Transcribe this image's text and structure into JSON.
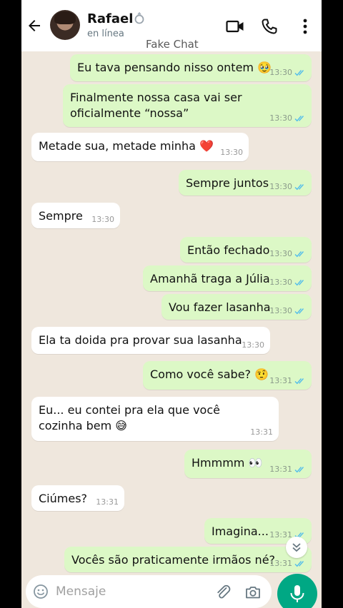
{
  "header": {
    "contact_name": "Rafael",
    "status": "en línea",
    "watermark": "Fake Chat"
  },
  "icons": {
    "back": "back-arrow-icon",
    "video": "video-call-icon",
    "call": "phone-icon",
    "more": "more-vertical-icon",
    "ring": "ring-icon",
    "emoji": "emoji-icon",
    "attach": "paperclip-icon",
    "camera": "camera-icon",
    "mic": "microphone-icon",
    "scroll": "double-chevron-down-icon"
  },
  "colors": {
    "outgoing_bubble": "#dcf8c6",
    "incoming_bubble": "#ffffff",
    "chat_background": "#efe7dd",
    "read_ticks": "#53bdeb",
    "accent": "#00a884"
  },
  "messages": [
    {
      "dir": "out",
      "text": "Eu tava pensando nisso ontem 🥹",
      "time": "13:30",
      "read": true
    },
    {
      "dir": "out",
      "text": "Finalmente nossa casa vai ser oficialmente “nossa”",
      "time": "13:30",
      "read": true
    },
    {
      "dir": "in",
      "text": "Metade sua, metade minha ❤️",
      "time": "13:30"
    },
    {
      "dir": "out",
      "text": "Sempre juntos",
      "time": "13:30",
      "read": true
    },
    {
      "dir": "in",
      "text": "Sempre",
      "time": "13:30"
    },
    {
      "dir": "out",
      "text": "Então fechado",
      "time": "13:30",
      "read": true
    },
    {
      "dir": "out",
      "text": "Amanhã traga a Júlia",
      "time": "13:30",
      "read": true
    },
    {
      "dir": "out",
      "text": "Vou fazer lasanha",
      "time": "13:30",
      "read": true
    },
    {
      "dir": "in",
      "text": "Ela ta doida pra provar sua lasanha",
      "time": "13:30"
    },
    {
      "dir": "out",
      "text": "Como você sabe? 🤨",
      "time": "13:31",
      "read": true
    },
    {
      "dir": "in",
      "text": "Eu... eu contei pra ela que você cozinha bem 😅",
      "time": "13:31"
    },
    {
      "dir": "out",
      "text": "Hmmmm 👀",
      "time": "13:31",
      "read": true
    },
    {
      "dir": "in",
      "text": "Ciúmes?",
      "time": "13:31"
    },
    {
      "dir": "out",
      "text": "Imagina...",
      "time": "13:31",
      "read": true
    },
    {
      "dir": "out",
      "text": "Vocês são praticamente irmãos né?",
      "time": "13:31",
      "read": true
    }
  ],
  "composer": {
    "placeholder": "Mensaje"
  }
}
